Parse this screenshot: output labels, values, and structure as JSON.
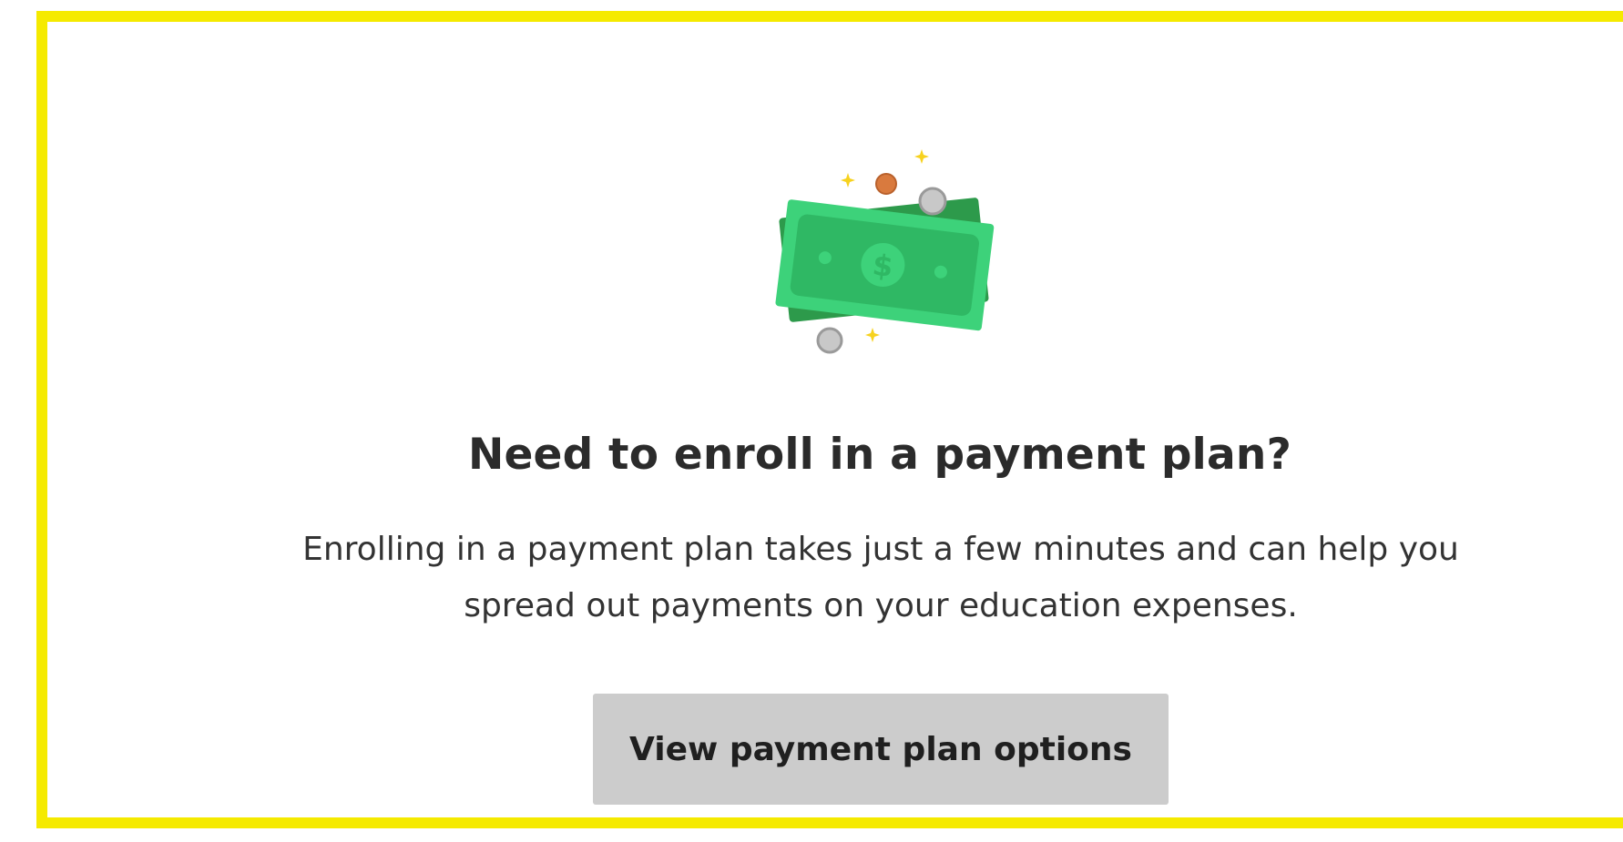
{
  "card": {
    "border_color": "#f5ea00",
    "illustration_icon": "money-bills-coins-icon",
    "title": "Need to enroll in a payment plan?",
    "description": "Enrolling in a payment plan takes just a few minutes and can help you spread out payments on your education expenses.",
    "cta_label": "View payment plan options",
    "cta_color": "#cccccc"
  }
}
